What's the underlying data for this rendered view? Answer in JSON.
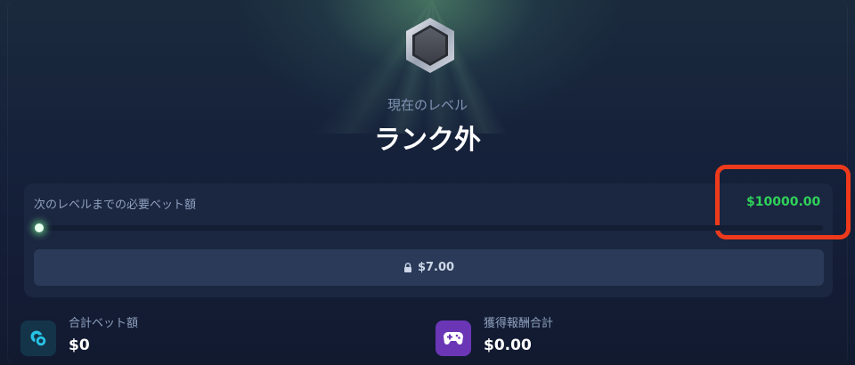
{
  "header": {
    "caption": "現在のレベル",
    "level_name": "ランク外"
  },
  "progress": {
    "label": "次のレベルまでの必要ベット額",
    "required_amount": "$10000.00",
    "progress_fraction": 0.0,
    "locked_amount": "$7.00"
  },
  "stats": {
    "total_bet": {
      "label": "合計ベット額",
      "value": "$0",
      "icon": "coins-icon"
    },
    "total_rewards": {
      "label": "獲得報酬合計",
      "value": "$0.00",
      "icon": "gamepad-icon"
    }
  },
  "colors": {
    "accent_green": "#2fd25a",
    "highlight_red": "#ee3a1c",
    "total_bet_icon_bg": "#1c8aa8",
    "total_rewards_icon_bg": "#7b3fc9"
  }
}
